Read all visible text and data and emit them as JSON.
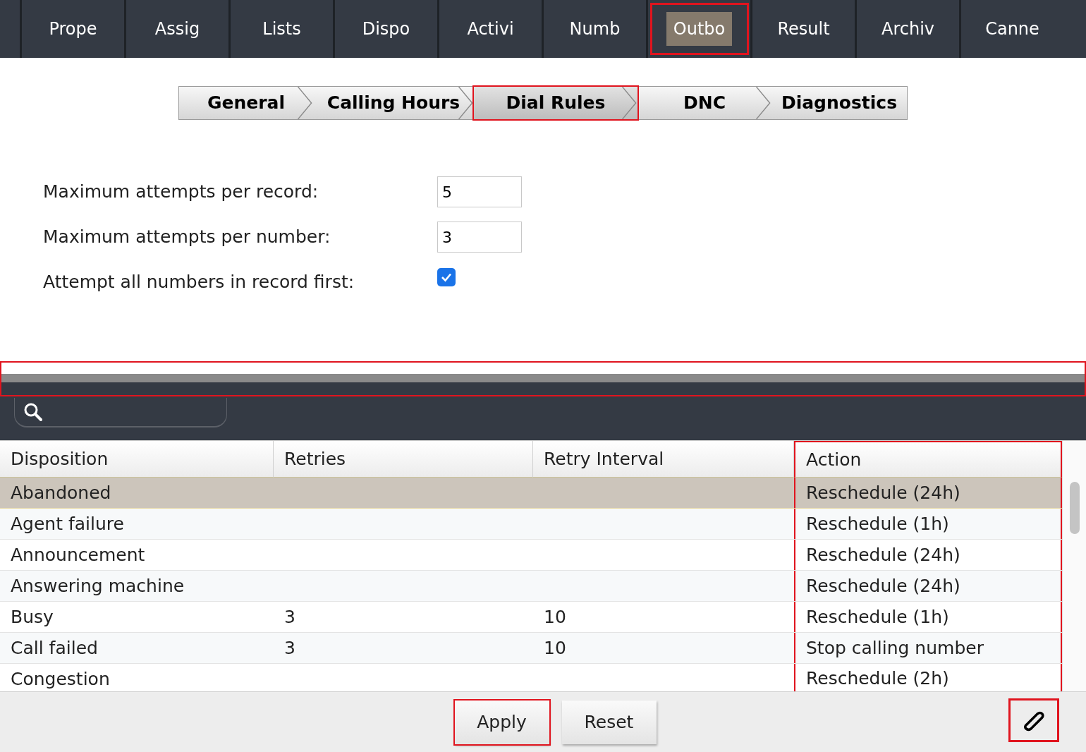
{
  "nav_tabs": [
    {
      "label": "Prope",
      "selected": false,
      "highlighted": false
    },
    {
      "label": "Assig",
      "selected": false,
      "highlighted": false
    },
    {
      "label": "Lists",
      "selected": false,
      "highlighted": false
    },
    {
      "label": "Dispo",
      "selected": false,
      "highlighted": false
    },
    {
      "label": "Activi",
      "selected": false,
      "highlighted": false
    },
    {
      "label": "Numb",
      "selected": false,
      "highlighted": false
    },
    {
      "label": "Outbo",
      "selected": true,
      "highlighted": true
    },
    {
      "label": "Result",
      "selected": false,
      "highlighted": false
    },
    {
      "label": "Archiv",
      "selected": false,
      "highlighted": false
    },
    {
      "label": "Canne",
      "selected": false,
      "highlighted": false
    }
  ],
  "sub_tabs": [
    {
      "label": "General",
      "selected": false,
      "highlighted": false
    },
    {
      "label": "Calling Hours",
      "selected": false,
      "highlighted": false
    },
    {
      "label": "Dial Rules",
      "selected": true,
      "highlighted": true
    },
    {
      "label": "DNC",
      "selected": false,
      "highlighted": false
    },
    {
      "label": "Diagnostics",
      "selected": false,
      "highlighted": false
    }
  ],
  "form": [
    {
      "kind": "text",
      "label": "Maximum attempts per record:",
      "value": "5"
    },
    {
      "kind": "text",
      "label": "Maximum attempts per number:",
      "value": "3"
    },
    {
      "kind": "checkbox",
      "label": "Attempt all numbers in record first:",
      "checked": true
    }
  ],
  "splitter": {
    "highlighted": true
  },
  "table": {
    "columns": [
      {
        "label": "Disposition",
        "highlighted": false
      },
      {
        "label": "Retries",
        "highlighted": false
      },
      {
        "label": "Retry Interval",
        "highlighted": false
      },
      {
        "label": "Action",
        "highlighted": true
      }
    ],
    "rows": [
      {
        "selected": true,
        "cells": [
          "Abandoned",
          "",
          "",
          "Reschedule (24h)"
        ]
      },
      {
        "selected": false,
        "cells": [
          "Agent failure",
          "",
          "",
          "Reschedule (1h)"
        ]
      },
      {
        "selected": false,
        "cells": [
          "Announcement",
          "",
          "",
          "Reschedule (24h)"
        ]
      },
      {
        "selected": false,
        "cells": [
          "Answering machine",
          "",
          "",
          "Reschedule (24h)"
        ]
      },
      {
        "selected": false,
        "cells": [
          "Busy",
          "3",
          "10",
          "Reschedule (1h)"
        ]
      },
      {
        "selected": false,
        "cells": [
          "Call failed",
          "3",
          "10",
          "Stop calling number"
        ]
      },
      {
        "selected": false,
        "cells": [
          "Congestion",
          "",
          "",
          "Reschedule (2h)"
        ]
      }
    ]
  },
  "buttons": [
    {
      "label": "Apply",
      "highlighted": true
    },
    {
      "label": "Reset",
      "highlighted": false
    }
  ],
  "edit_button": {
    "highlighted": true
  }
}
